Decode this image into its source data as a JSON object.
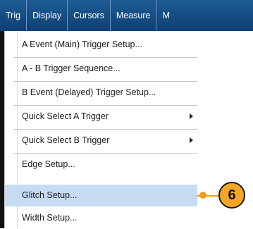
{
  "menubar": {
    "items": [
      "Trig",
      "Display",
      "Cursors",
      "Measure",
      "M"
    ]
  },
  "menu": {
    "items": [
      {
        "label": "A Event (Main) Trigger Setup...",
        "submenu": false,
        "selected": false
      },
      {
        "label": "A - B Trigger Sequence...",
        "submenu": false,
        "selected": false
      },
      {
        "label": "B Event (Delayed) Trigger Setup...",
        "submenu": false,
        "selected": false
      },
      {
        "label": "Quick Select A Trigger",
        "submenu": true,
        "selected": false
      },
      {
        "label": "Quick Select B Trigger",
        "submenu": true,
        "selected": false
      },
      {
        "label": "Edge Setup...",
        "submenu": false,
        "selected": false
      },
      {
        "label": "Glitch Setup...",
        "submenu": false,
        "selected": true
      },
      {
        "label": "Width Setup...",
        "submenu": false,
        "selected": false
      }
    ]
  },
  "callout": {
    "number": "6",
    "color": "#f6a623"
  },
  "colors": {
    "menubar": "#1d5c95",
    "selected_row": "#c7dcf2",
    "leader": "#f29a1d"
  }
}
